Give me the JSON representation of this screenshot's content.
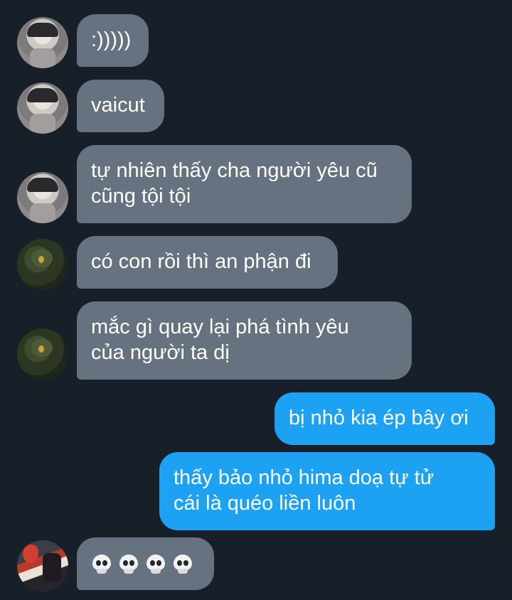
{
  "conversation": {
    "messages": [
      {
        "sender": "user-a",
        "text": ":)))))"
      },
      {
        "sender": "user-a",
        "text": "vaicut"
      },
      {
        "sender": "user-a",
        "text": "tự nhiên thấy cha người yêu cũ\ncũng tội tội"
      },
      {
        "sender": "user-b",
        "text": "có con rồi thì an phận đi"
      },
      {
        "sender": "user-b",
        "text": "mắc gì quay lại phá tình yêu\ncủa người ta dị"
      },
      {
        "sender": "me",
        "text": "bị nhỏ kia ép bây ơi"
      },
      {
        "sender": "me",
        "text": "thấy bảo nhỏ hima doạ tự tử\ncái là quéo liền luôn"
      },
      {
        "sender": "user-c",
        "text": "💀💀💀💀",
        "icon": "skull-emoji"
      }
    ]
  },
  "colors": {
    "background": "#172029",
    "received_bubble": "#66727f",
    "sent_bubble": "#1da1f2",
    "text": "#ffffff"
  }
}
